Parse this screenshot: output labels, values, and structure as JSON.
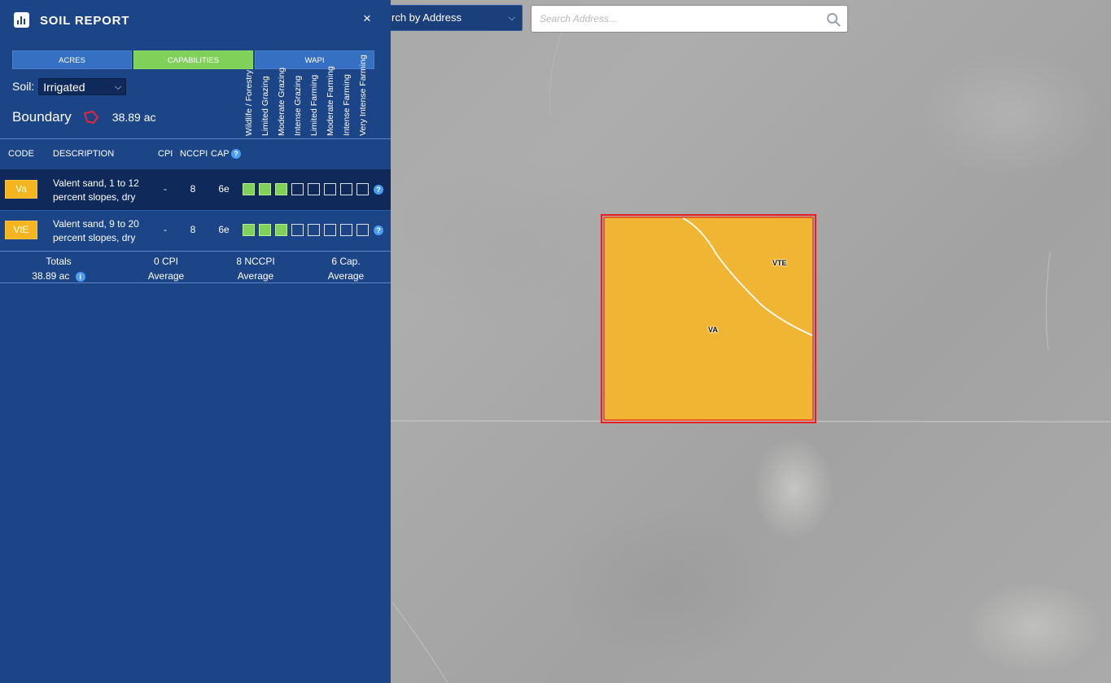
{
  "search": {
    "mode_label": "rch by Address",
    "placeholder": "Search Address..."
  },
  "map": {
    "labels": {
      "va": "VA",
      "vte": "VTE"
    },
    "parcel_fill": "#f0b633",
    "parcel_border": "#e81e26"
  },
  "panel": {
    "title": "SOIL REPORT",
    "close_icon": "×",
    "tabs": [
      {
        "label": "ACRES",
        "active": false
      },
      {
        "label": "CAPABILITIES",
        "active": true
      },
      {
        "label": "WAPI",
        "active": false
      }
    ],
    "soil": {
      "label": "Soil:",
      "selected": "Irrigated"
    },
    "boundary": {
      "label": "Boundary",
      "acres": "38.89 ac"
    },
    "capability_headers": [
      "Wildlife / Forestry",
      "Limited Grazing",
      "Moderate Grazing",
      "Intense Grazing",
      "Limited Farming",
      "Moderate Farming",
      "Intense Farming",
      "Very Intense Farming"
    ],
    "columns": {
      "code": "CODE",
      "description": "DESCRIPTION",
      "cpi": "CPI",
      "nccpi": "NCCPI",
      "cap": "CAP"
    },
    "rows": [
      {
        "code": "Va",
        "description": "Valent sand, 1 to 12 percent slopes, dry",
        "cpi": "-",
        "nccpi": "8",
        "cap": "6e",
        "levels": 3
      },
      {
        "code": "VtE",
        "description": "Valent sand, 9 to 20 percent slopes, dry",
        "cpi": "-",
        "nccpi": "8",
        "cap": "6e",
        "levels": 3
      }
    ],
    "totals": {
      "label": "Totals",
      "acres": "38.89 ac",
      "cpi": "0 CPI",
      "cpi_sub": "Average",
      "nccpi": "8 NCCPI",
      "nccpi_sub": "Average",
      "cap": "6 Cap.",
      "cap_sub": "Average"
    },
    "colors": {
      "panel_bg": "#1c4587",
      "active_tab": "#7fd15a",
      "badge": "#f5b51e"
    }
  }
}
